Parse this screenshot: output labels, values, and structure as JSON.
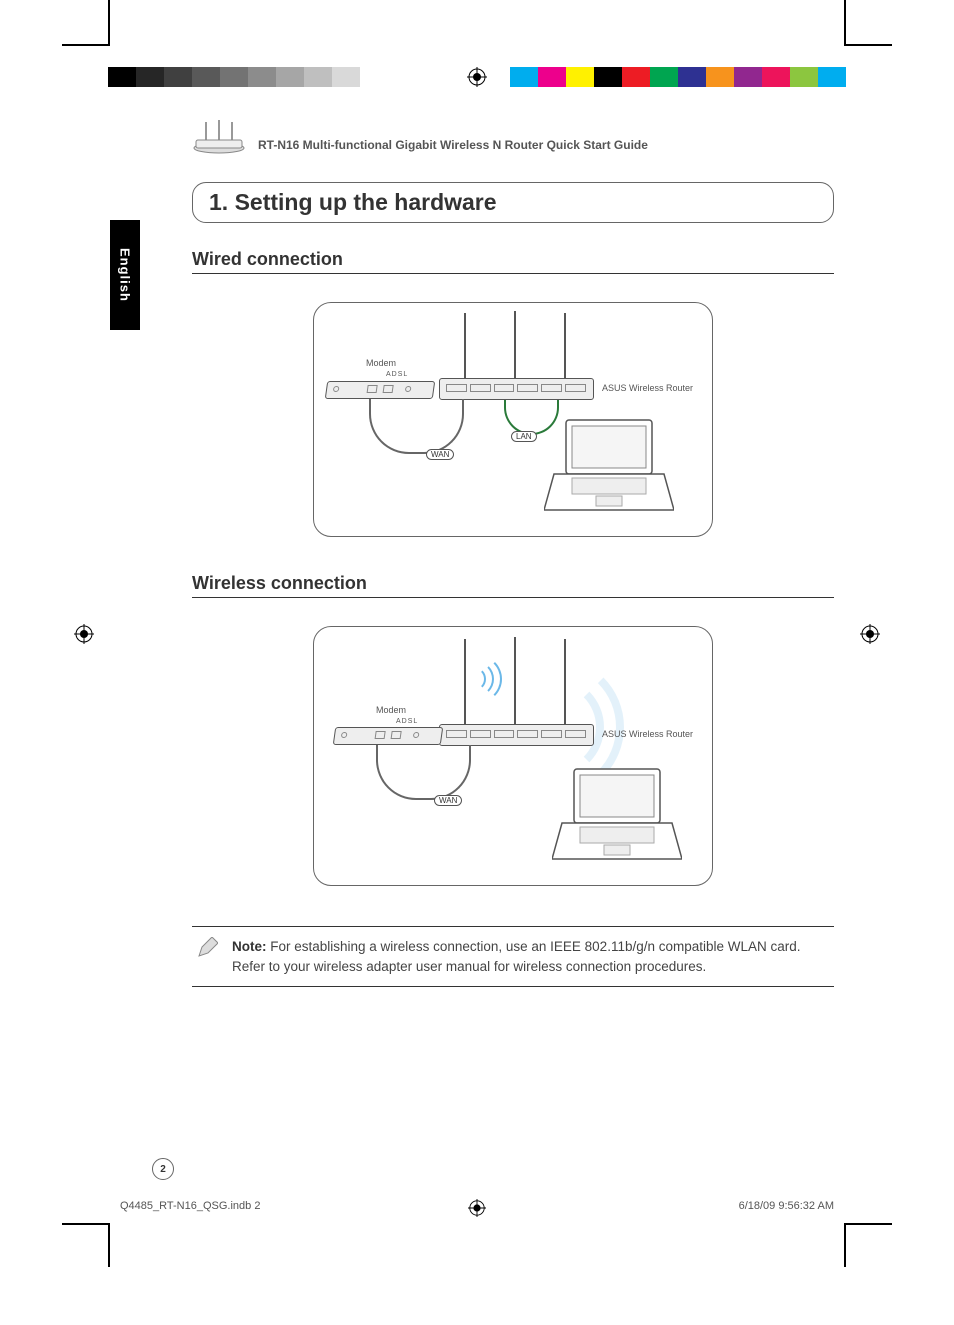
{
  "print": {
    "grayscale": [
      "#000000",
      "#262626",
      "#404040",
      "#595959",
      "#737373",
      "#8c8c8c",
      "#a6a6a6",
      "#bfbfbf",
      "#d9d9d9",
      "#ffffff"
    ],
    "colors": [
      "#00adee",
      "#ed008c",
      "#fff100",
      "#000000",
      "#ed1c24",
      "#00a550",
      "#2e3192",
      "#f7931d",
      "#91278f",
      "#ed145b",
      "#8cc63f",
      "#00adef"
    ]
  },
  "header": {
    "doc_title": "RT-N16 Multi-functional Gigabit Wireless N Router Quick Start Guide"
  },
  "lang_tab": "English",
  "section_title": "1. Setting up the hardware",
  "sub1": "Wired connection",
  "sub2": "Wireless connection",
  "diagram": {
    "modem_label": "Modem",
    "router_label": "ASUS Wireless Router",
    "wan_label": "WAN",
    "lan_label": "LAN",
    "adsl_label": "ADSL"
  },
  "note": {
    "label": "Note:",
    "body": " For establishing a wireless connection, use an IEEE 802.11b/g/n compatible WLAN card. Refer to your wireless adapter user manual for wireless connection procedures."
  },
  "page_number": "2",
  "footer": {
    "file": "Q4485_RT-N16_QSG.indb   2",
    "timestamp": "6/18/09   9:56:32 AM"
  }
}
